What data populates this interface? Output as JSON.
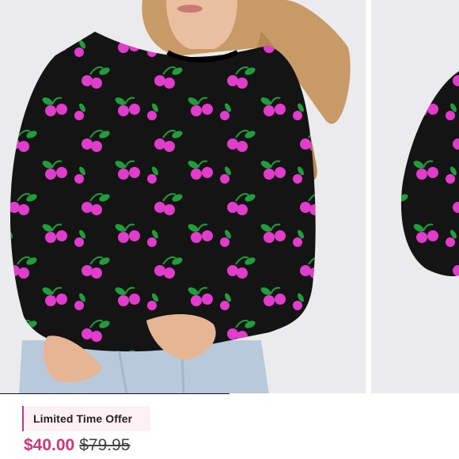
{
  "product": {
    "image_alt": "Model wearing black knit sweater with pink cherry pattern",
    "gallery_progress": 0.5
  },
  "offer": {
    "label": "Limited Time Offer"
  },
  "pricing": {
    "sale_price": "$40.00",
    "original_price": "$79.95"
  },
  "colors": {
    "accent": "#d1347f",
    "sweater": "#141414",
    "cherry": "#e23ccc",
    "leaf": "#1f9e3a",
    "backdrop": "#ebebed",
    "badge_bg": "#fdf1f5"
  }
}
